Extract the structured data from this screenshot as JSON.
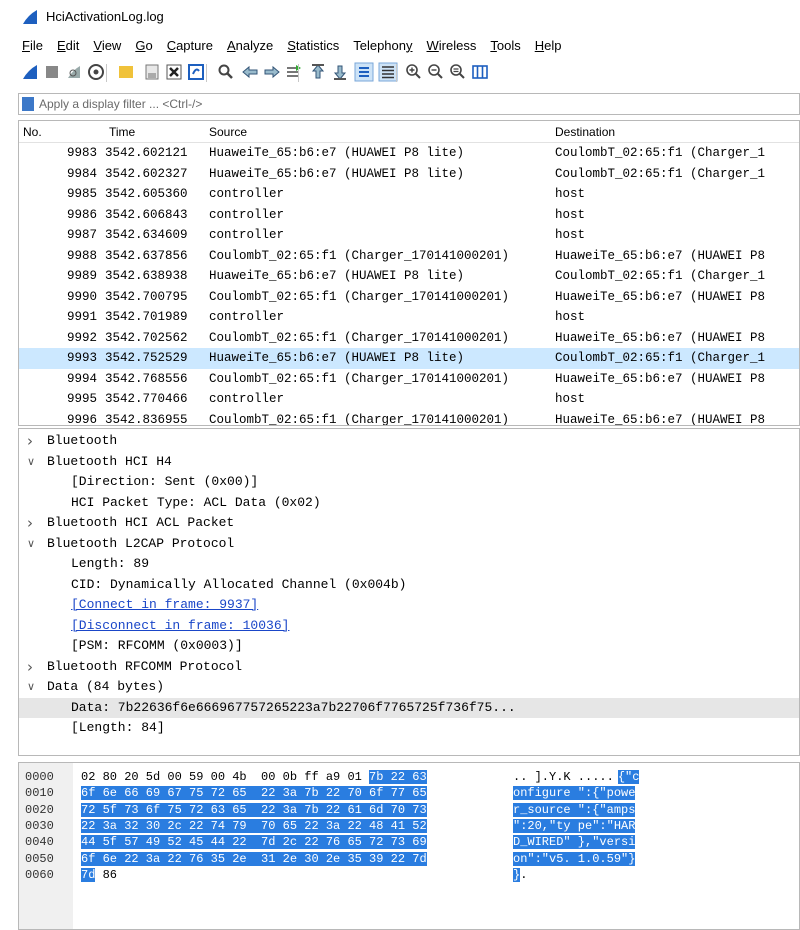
{
  "window": {
    "title": "HciActivationLog.log"
  },
  "menu": [
    {
      "label": "File",
      "ul": "F",
      "rest": "ile"
    },
    {
      "label": "Edit",
      "ul": "E",
      "rest": "dit"
    },
    {
      "label": "View",
      "ul": "V",
      "rest": "iew"
    },
    {
      "label": "Go",
      "ul": "G",
      "rest": "o"
    },
    {
      "label": "Capture",
      "ul": "C",
      "rest": "apture"
    },
    {
      "label": "Analyze",
      "ul": "A",
      "rest": "nalyze"
    },
    {
      "label": "Statistics",
      "ul": "S",
      "rest": "tatistics"
    },
    {
      "label": "Telephony",
      "pre": "Telephon",
      "ul": "y",
      "rest": ""
    },
    {
      "label": "Wireless",
      "ul": "W",
      "rest": "ireless"
    },
    {
      "label": "Tools",
      "ul": "T",
      "rest": "ools"
    },
    {
      "label": "Help",
      "ul": "H",
      "rest": "elp"
    }
  ],
  "toolbar_icons": [
    "shark-fin-icon",
    "stop-icon",
    "restart-icon",
    "options-icon",
    "open-icon",
    "save-icon",
    "close-file-icon",
    "reload-icon",
    "find-icon",
    "back-icon",
    "forward-icon",
    "go-to-icon",
    "first-icon",
    "last-icon",
    "autoscroll-icon",
    "colorize-icon",
    "zoom-in-icon",
    "zoom-out-icon",
    "zoom-normal-icon",
    "resize-columns-icon"
  ],
  "filter": {
    "placeholder": "Apply a display filter ... <Ctrl-/>"
  },
  "packet_list": {
    "columns": {
      "no": "No.",
      "time": "Time",
      "source": "Source",
      "destination": "Destination"
    },
    "rows": [
      {
        "no": "9983",
        "time": "3542.602121",
        "source": "HuaweiTe_65:b6:e7 (HUAWEI P8 lite)",
        "destination": "CoulombT_02:65:f1 (Charger_1",
        "selected": false
      },
      {
        "no": "9984",
        "time": "3542.602327",
        "source": "HuaweiTe_65:b6:e7 (HUAWEI P8 lite)",
        "destination": "CoulombT_02:65:f1 (Charger_1",
        "selected": false
      },
      {
        "no": "9985",
        "time": "3542.605360",
        "source": "controller",
        "destination": "host",
        "selected": false
      },
      {
        "no": "9986",
        "time": "3542.606843",
        "source": "controller",
        "destination": "host",
        "selected": false
      },
      {
        "no": "9987",
        "time": "3542.634609",
        "source": "controller",
        "destination": "host",
        "selected": false
      },
      {
        "no": "9988",
        "time": "3542.637856",
        "source": "CoulombT_02:65:f1 (Charger_170141000201)",
        "destination": "HuaweiTe_65:b6:e7 (HUAWEI P8",
        "selected": false
      },
      {
        "no": "9989",
        "time": "3542.638938",
        "source": "HuaweiTe_65:b6:e7 (HUAWEI P8 lite)",
        "destination": "CoulombT_02:65:f1 (Charger_1",
        "selected": false
      },
      {
        "no": "9990",
        "time": "3542.700795",
        "source": "CoulombT_02:65:f1 (Charger_170141000201)",
        "destination": "HuaweiTe_65:b6:e7 (HUAWEI P8",
        "selected": false
      },
      {
        "no": "9991",
        "time": "3542.701989",
        "source": "controller",
        "destination": "host",
        "selected": false
      },
      {
        "no": "9992",
        "time": "3542.702562",
        "source": "CoulombT_02:65:f1 (Charger_170141000201)",
        "destination": "HuaweiTe_65:b6:e7 (HUAWEI P8",
        "selected": false
      },
      {
        "no": "9993",
        "time": "3542.752529",
        "source": "HuaweiTe_65:b6:e7 (HUAWEI P8 lite)",
        "destination": "CoulombT_02:65:f1 (Charger_1",
        "selected": true
      },
      {
        "no": "9994",
        "time": "3542.768556",
        "source": "CoulombT_02:65:f1 (Charger_170141000201)",
        "destination": "HuaweiTe_65:b6:e7 (HUAWEI P8",
        "selected": false
      },
      {
        "no": "9995",
        "time": "3542.770466",
        "source": "controller",
        "destination": "host",
        "selected": false
      },
      {
        "no": "9996",
        "time": "3542.836955",
        "source": "CoulombT_02:65:f1 (Charger_170141000201)",
        "destination": "HuaweiTe_65:b6:e7 (HUAWEI P8",
        "selected": false
      }
    ]
  },
  "details": [
    {
      "text": "Bluetooth",
      "arrow": "collapsed",
      "indent": 0,
      "link": false,
      "highlighted": false
    },
    {
      "text": "Bluetooth HCI H4",
      "arrow": "expanded",
      "indent": 0,
      "link": false,
      "highlighted": false
    },
    {
      "text": "[Direction: Sent (0x00)]",
      "arrow": "none",
      "indent": 1,
      "link": false,
      "highlighted": false
    },
    {
      "text": "HCI Packet Type: ACL Data (0x02)",
      "arrow": "none",
      "indent": 1,
      "link": false,
      "highlighted": false
    },
    {
      "text": "Bluetooth HCI ACL Packet",
      "arrow": "collapsed",
      "indent": 0,
      "link": false,
      "highlighted": false
    },
    {
      "text": "Bluetooth L2CAP Protocol",
      "arrow": "expanded",
      "indent": 0,
      "link": false,
      "highlighted": false
    },
    {
      "text": "Length: 89",
      "arrow": "none",
      "indent": 1,
      "link": false,
      "highlighted": false
    },
    {
      "text": "CID: Dynamically Allocated Channel (0x004b)",
      "arrow": "none",
      "indent": 1,
      "link": false,
      "highlighted": false
    },
    {
      "text": "[Connect in frame: 9937]",
      "arrow": "none",
      "indent": 1,
      "link": true,
      "highlighted": false
    },
    {
      "text": "[Disconnect in frame: 10036]",
      "arrow": "none",
      "indent": 1,
      "link": true,
      "highlighted": false
    },
    {
      "text": "[PSM: RFCOMM (0x0003)]",
      "arrow": "none",
      "indent": 1,
      "link": false,
      "highlighted": false
    },
    {
      "text": "Bluetooth RFCOMM Protocol",
      "arrow": "collapsed",
      "indent": 0,
      "link": false,
      "highlighted": false
    },
    {
      "text": "Data (84 bytes)",
      "arrow": "expanded",
      "indent": 0,
      "link": false,
      "highlighted": false
    },
    {
      "text": "Data: 7b22636f6e666967757265223a7b22706f7765725f736f75...",
      "arrow": "none",
      "indent": 1,
      "link": false,
      "highlighted": true
    },
    {
      "text": "[Length: 84]",
      "arrow": "none",
      "indent": 1,
      "link": false,
      "highlighted": false
    }
  ],
  "hex_dump": [
    {
      "offset": "0000",
      "hex_plain": "02 80 20 5d 00 59 00 4b  00 0b ff a9 01 ",
      "hex_hl": "7b 22 63",
      "ascii_plain": ".. ].Y.K .....",
      "ascii_hl": "{\"c"
    },
    {
      "offset": "0010",
      "hex_plain": "",
      "hex_hl": "6f 6e 66 69 67 75 72 65  22 3a 7b 22 70 6f 77 65",
      "ascii_plain": "",
      "ascii_hl": "onfigure \":{\"powe"
    },
    {
      "offset": "0020",
      "hex_plain": "",
      "hex_hl": "72 5f 73 6f 75 72 63 65  22 3a 7b 22 61 6d 70 73",
      "ascii_plain": "",
      "ascii_hl": "r_source \":{\"amps"
    },
    {
      "offset": "0030",
      "hex_plain": "",
      "hex_hl": "22 3a 32 30 2c 22 74 79  70 65 22 3a 22 48 41 52",
      "ascii_plain": "",
      "ascii_hl": "\":20,\"ty pe\":\"HAR"
    },
    {
      "offset": "0040",
      "hex_plain": "",
      "hex_hl": "44 5f 57 49 52 45 44 22  7d 2c 22 76 65 72 73 69",
      "ascii_plain": "",
      "ascii_hl": "D_WIRED\" },\"versi"
    },
    {
      "offset": "0050",
      "hex_plain": "",
      "hex_hl": "6f 6e 22 3a 22 76 35 2e  31 2e 30 2e 35 39 22 7d",
      "ascii_plain": "",
      "ascii_hl": "on\":\"v5. 1.0.59\"}"
    },
    {
      "offset": "0060",
      "hex_plain": " 86",
      "hex_hl": "7d",
      "ascii_plain": ".",
      "ascii_hl": "}"
    }
  ]
}
